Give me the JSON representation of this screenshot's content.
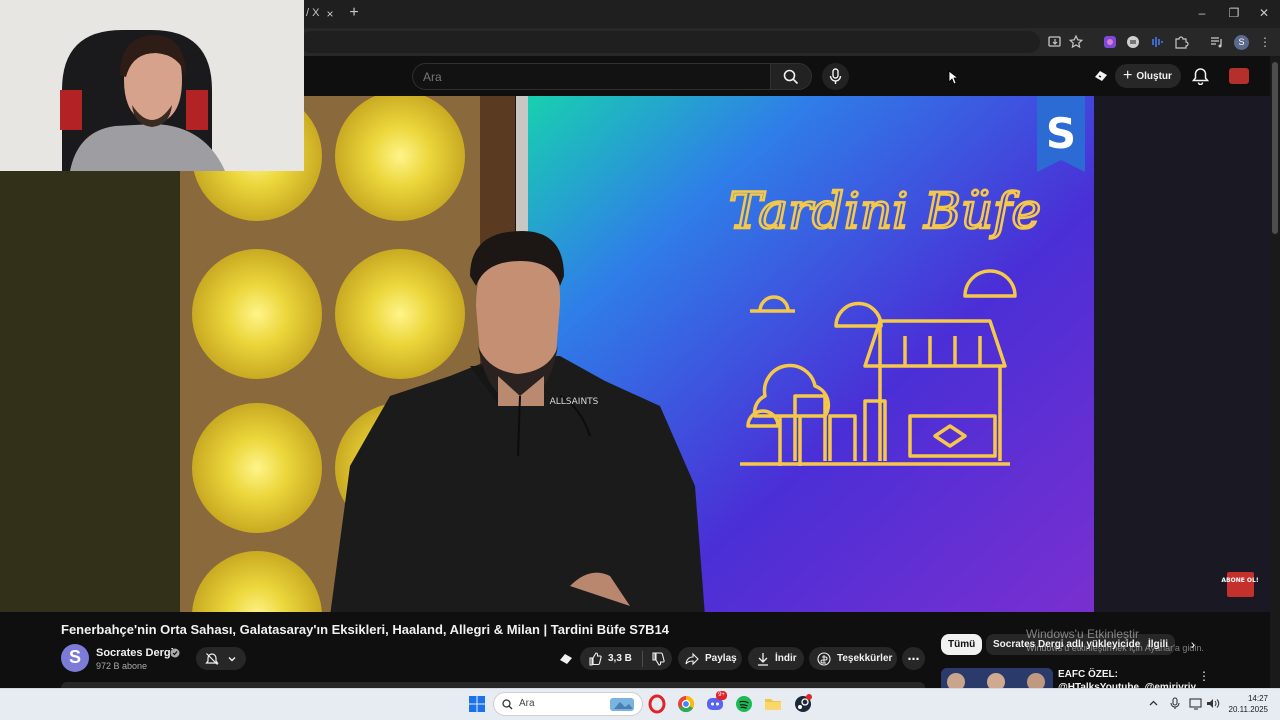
{
  "browser": {
    "tab_title_tail": "/ X",
    "tab_close": "×",
    "new_tab": "+",
    "window_controls": {
      "minimize": "–",
      "maximize": "❐",
      "close": "✕"
    },
    "profile_initial": "S"
  },
  "youtube": {
    "search_placeholder": "Ara",
    "create_label": "Oluştur",
    "create_plus": "+"
  },
  "video": {
    "show_title": "Tardini Büfe",
    "logo_letter": "S",
    "shirt_brand": "ALLSAINTS",
    "subscribe_badge": "ABONE OL!",
    "title": "Fenerbahçe'nin Orta Sahası, Galatasaray'ın Eksikleri, Haaland, Allegri & Milan | Tardini Büfe S7B14"
  },
  "channel": {
    "avatar_letter": "S",
    "name": "Socrates Dergi",
    "subscribers": "972 B abone"
  },
  "actions": {
    "like_count": "3,3 B",
    "share": "Paylaş",
    "download": "İndir",
    "thanks": "Teşekkürler",
    "more": "⋯"
  },
  "chips": {
    "all": "Tümü",
    "from_uploader": "Socrates Dergi adlı yükleyiciden",
    "related": "İlgili",
    "next": "›"
  },
  "recommendation": {
    "title": "EAFC ÖZEL: @HTalksYoutube, @emirivriy VS @EgeArsever"
  },
  "windows": {
    "activate_title": "Windows'u Etkinleştir",
    "activate_sub": "Windows'u etkinleştirmek için Ayarlar'a gidin."
  },
  "taskbar": {
    "search_placeholder": "Ara",
    "discord_badge": "9+",
    "time": "14:27",
    "date": "20.11.2025"
  },
  "colors": {
    "accent_red": "#c4302b",
    "stage_purple": "#4a2fd6",
    "stage_teal": "#18c8b0",
    "neon_yellow": "#f5c84a",
    "channel_avatar": "#7c7bd8"
  }
}
